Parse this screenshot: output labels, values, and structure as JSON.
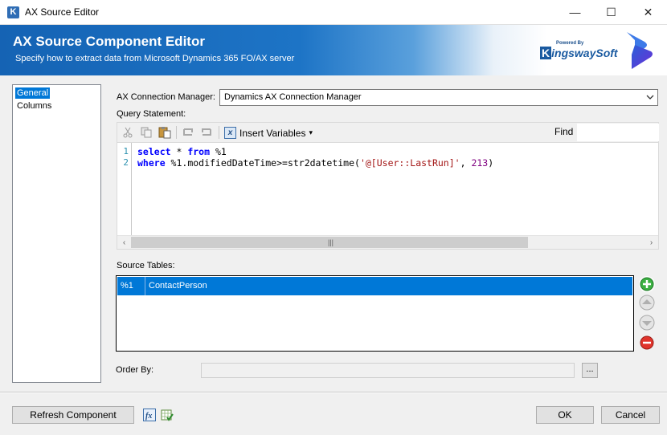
{
  "window": {
    "title": "AX Source Editor",
    "icon": "K",
    "minimize_icon": "—",
    "maximize_icon": "☐",
    "close_icon": "✕"
  },
  "header": {
    "title": "AX Source Component Editor",
    "subtitle": "Specify how to extract data from Microsoft Dynamics 365 FO/AX server",
    "brand_small": "Powered By",
    "brand_k": "K",
    "brand_name": "ingswaySoft"
  },
  "nav": {
    "items": [
      {
        "label": "General",
        "selected": true
      },
      {
        "label": "Columns",
        "selected": false
      }
    ]
  },
  "connection": {
    "label": "AX Connection Manager:",
    "value": "Dynamics AX Connection Manager"
  },
  "query": {
    "label": "Query Statement:",
    "toolbar": {
      "insert_variables": "Insert Variables",
      "insert_arrow": "▾",
      "fx": "x",
      "find_label": "Find"
    },
    "lines": [
      {
        "number": "1",
        "kw1": "select",
        "t1": " * ",
        "kw2": "from",
        "t2": " %1"
      },
      {
        "number": "2",
        "kw1": "where",
        "t1": " %1.modifiedDateTime>=str2datetime(",
        "str": "'@[User::LastRun]'",
        "t2": ", ",
        "num": "213",
        "t3": ")"
      }
    ]
  },
  "source_tables": {
    "label": "Source Tables:",
    "rows": [
      {
        "alias": "%1",
        "name": "ContactPerson",
        "selected": true
      }
    ]
  },
  "order_by": {
    "label": "Order By:",
    "value": "",
    "browse": "..."
  },
  "footer": {
    "refresh": "Refresh Component",
    "ok": "OK",
    "cancel": "Cancel"
  },
  "colors": {
    "accent": "#0078d7",
    "banner": "#1d74c6"
  }
}
